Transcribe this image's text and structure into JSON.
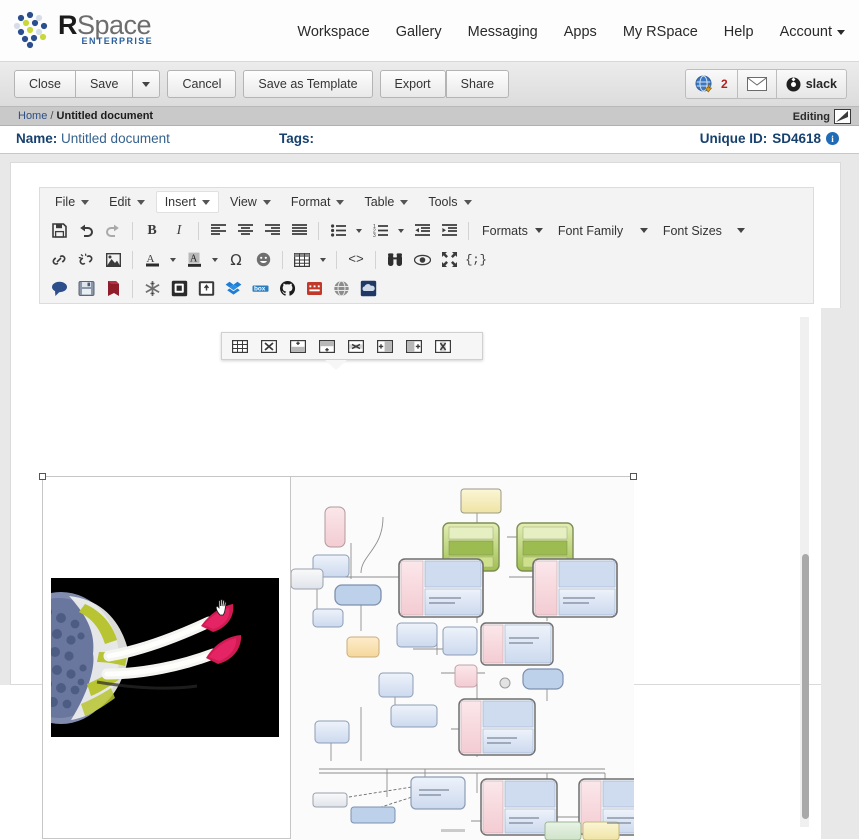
{
  "app": {
    "logo_primary": "R",
    "logo_secondary": "Space",
    "logo_edition": "ENTERPRISE"
  },
  "topnav": {
    "items": [
      {
        "label": "Workspace",
        "icon": ""
      },
      {
        "label": "Gallery",
        "icon": ""
      },
      {
        "label": "Messaging",
        "icon": ""
      },
      {
        "label": "Apps",
        "icon": ""
      },
      {
        "label": "My RSpace",
        "icon": ""
      },
      {
        "label": "Help",
        "icon": ""
      },
      {
        "label": "Account",
        "icon": "chevron-down-icon"
      }
    ]
  },
  "actionbar": {
    "close_label": "Close",
    "save_label": "Save",
    "save_dropdown_icon": "chevron-down-icon",
    "cancel_label": "Cancel",
    "save_as_template_label": "Save as Template",
    "export_label": "Export",
    "share_label": "Share",
    "notification_icon": "globe-download-icon",
    "notification_count": "2",
    "mail_icon": "envelope-icon",
    "slack_icon": "slack-icon",
    "slack_label": "slack"
  },
  "breadcrumb": {
    "home_label": "Home",
    "separator": "/",
    "current_label": "Untitled document",
    "editing_label": "Editing",
    "editing_icon": "resize-pencil-icon"
  },
  "namebar": {
    "name_label": "Name:",
    "name_value": "Untitled document",
    "tags_label": "Tags:",
    "tags_value": "",
    "unique_id_label": "Unique ID:",
    "unique_id_value": "SD4618",
    "info_icon": "info-icon",
    "info_glyph": "i"
  },
  "editor": {
    "menubar": [
      {
        "label": "File",
        "active": false
      },
      {
        "label": "Edit",
        "active": false
      },
      {
        "label": "Insert",
        "active": true
      },
      {
        "label": "View",
        "active": false
      },
      {
        "label": "Format",
        "active": false
      },
      {
        "label": "Table",
        "active": false
      },
      {
        "label": "Tools",
        "active": false
      }
    ],
    "toolbar_row1": [
      {
        "name": "save-icon",
        "kind": "icon"
      },
      {
        "name": "undo-icon",
        "kind": "icon"
      },
      {
        "name": "redo-icon",
        "kind": "icon"
      },
      {
        "name": "separator",
        "kind": "sep"
      },
      {
        "name": "bold-icon",
        "kind": "icon"
      },
      {
        "name": "italic-icon",
        "kind": "icon"
      },
      {
        "name": "separator",
        "kind": "sep"
      },
      {
        "name": "align-left-icon",
        "kind": "icon"
      },
      {
        "name": "align-center-icon",
        "kind": "icon"
      },
      {
        "name": "align-right-icon",
        "kind": "icon"
      },
      {
        "name": "align-justify-icon",
        "kind": "icon"
      },
      {
        "name": "separator",
        "kind": "sep"
      },
      {
        "name": "bullet-list-icon",
        "kind": "icon"
      },
      {
        "name": "bullet-list-caret",
        "kind": "caret"
      },
      {
        "name": "numbered-list-icon",
        "kind": "icon"
      },
      {
        "name": "numbered-list-caret",
        "kind": "caret"
      },
      {
        "name": "outdent-icon",
        "kind": "icon"
      },
      {
        "name": "indent-icon",
        "kind": "icon"
      }
    ],
    "toolbar_row1_labels": [
      {
        "label": "Formats",
        "caret": true
      },
      {
        "label": "Font Family",
        "caret": true
      },
      {
        "label": "Font Sizes",
        "caret": true
      }
    ],
    "toolbar_row2": [
      {
        "name": "link-icon"
      },
      {
        "name": "unlink-icon"
      },
      {
        "name": "image-icon"
      },
      {
        "name": "separator"
      },
      {
        "name": "text-color-icon"
      },
      {
        "name": "text-color-caret"
      },
      {
        "name": "background-color-icon"
      },
      {
        "name": "background-color-caret"
      },
      {
        "name": "special-character-icon"
      },
      {
        "name": "emoticon-icon"
      },
      {
        "name": "separator"
      },
      {
        "name": "table-icon"
      },
      {
        "name": "table-caret"
      },
      {
        "name": "separator"
      },
      {
        "name": "source-code-icon"
      },
      {
        "name": "separator"
      },
      {
        "name": "find-replace-icon"
      },
      {
        "name": "preview-icon"
      },
      {
        "name": "fullscreen-icon"
      },
      {
        "name": "code-sample-icon"
      }
    ],
    "toolbar_row3": [
      {
        "name": "comment-icon",
        "color": "#2c4f8c"
      },
      {
        "name": "internal-link-icon",
        "color": "#5a6f8a"
      },
      {
        "name": "bookmark-icon",
        "color": "#8f1d2a"
      },
      {
        "name": "separator",
        "color": ""
      },
      {
        "name": "snowflake-icon",
        "color": "#7a7a7a"
      },
      {
        "name": "chemistry-icon",
        "color": "#2b2b2b"
      },
      {
        "name": "attachment-icon",
        "color": "#3a3a3a"
      },
      {
        "name": "dropbox-icon",
        "color": "#1c7ed6"
      },
      {
        "name": "box-icon",
        "color": "#2a7ec0"
      },
      {
        "name": "github-icon",
        "color": "#1b1b1b"
      },
      {
        "name": "figshare-icon",
        "color": "#c0392b"
      },
      {
        "name": "globe-icon",
        "color": "#8c8c8c"
      },
      {
        "name": "onedrive-icon",
        "color": "#1f3864"
      }
    ],
    "table_popup": [
      {
        "name": "table-properties-icon"
      },
      {
        "name": "delete-table-icon"
      },
      {
        "name": "insert-row-before-icon"
      },
      {
        "name": "insert-row-after-icon"
      },
      {
        "name": "delete-row-icon"
      },
      {
        "name": "insert-column-before-icon"
      },
      {
        "name": "insert-column-after-icon"
      },
      {
        "name": "delete-column-icon"
      }
    ]
  },
  "content": {
    "table_selected": true,
    "cell_left_image_name": "fluorescence-microscopy-image",
    "cell_right_image_name": "pathway-workflow-diagram",
    "cursor_name": "hand-cursor"
  },
  "colors": {
    "link_blue": "#2c4e82",
    "heading_blue": "#16406e",
    "accent_red": "#b02020",
    "toolbar_grey": "#f3f3f3"
  }
}
